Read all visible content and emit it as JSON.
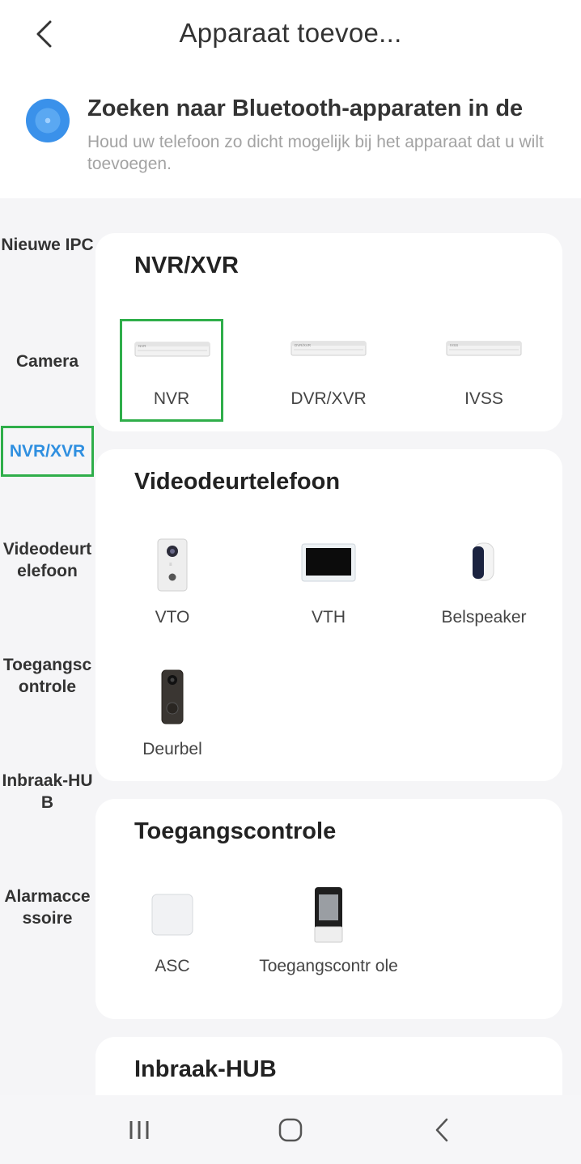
{
  "header": {
    "title": "Apparaat toevoe..."
  },
  "bluetooth": {
    "title": "Zoeken naar Bluetooth-apparaten in de",
    "description": "Houd uw telefoon zo dicht mogelijk bij het apparaat dat u wilt toevoegen."
  },
  "sidebar": {
    "items": [
      {
        "label": "Nieuwe IPC"
      },
      {
        "label": "Camera"
      },
      {
        "label": "NVR/XVR"
      },
      {
        "label": "Videodeurt elefoon"
      },
      {
        "label": "Toegangsc ontrole"
      },
      {
        "label": "Inbraak-HU B"
      },
      {
        "label": "Alarmacce ssoire"
      }
    ],
    "active_index": 2
  },
  "sections": [
    {
      "title": "NVR/XVR",
      "devices": [
        {
          "label": "NVR",
          "icon": "nvr-recorder-icon",
          "tag": "NVR"
        },
        {
          "label": "DVR/XVR",
          "icon": "dvr-recorder-icon",
          "tag": "DVR/XVR"
        },
        {
          "label": "IVSS",
          "icon": "ivss-recorder-icon",
          "tag": "IVSS"
        }
      ]
    },
    {
      "title": "Videodeurtelefoon",
      "devices": [
        {
          "label": "VTO",
          "icon": "vto-door-station-icon"
        },
        {
          "label": "VTH",
          "icon": "vth-monitor-icon"
        },
        {
          "label": "Belspeaker",
          "icon": "chime-speaker-icon"
        },
        {
          "label": "Deurbel",
          "icon": "doorbell-icon"
        }
      ]
    },
    {
      "title": "Toegangscontrole",
      "devices": [
        {
          "label": "ASC",
          "icon": "asc-controller-icon"
        },
        {
          "label": "Toegangscontr ole",
          "icon": "access-terminal-icon"
        }
      ]
    },
    {
      "title": "Inbraak-HUB",
      "devices": []
    }
  ],
  "colors": {
    "accent_blue": "#2f8fe0",
    "highlight_green": "#2fae4a",
    "background": "#f5f5f7"
  }
}
